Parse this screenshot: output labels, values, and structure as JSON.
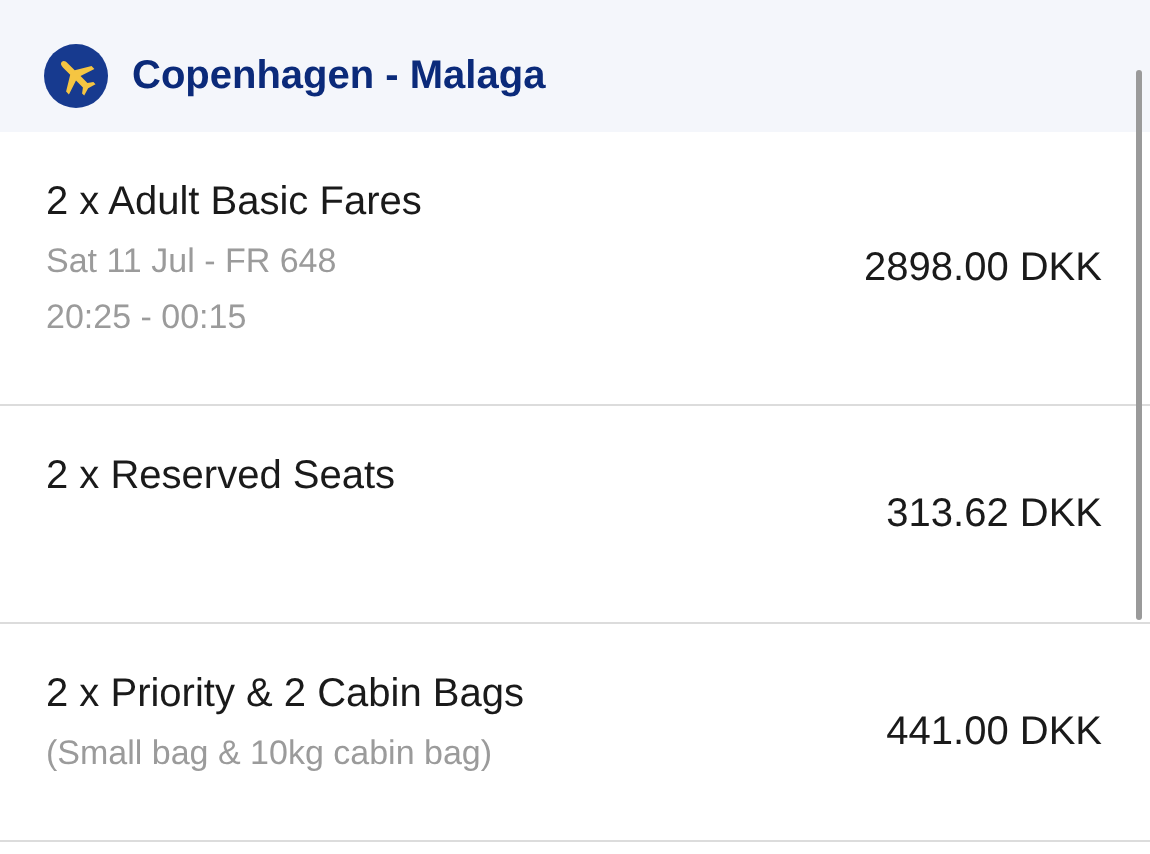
{
  "header": {
    "title": "Copenhagen - Malaga"
  },
  "items": [
    {
      "title": "2 x Adult Basic Fares",
      "details": [
        "Sat 11 Jul - FR 648",
        "20:25 - 00:15"
      ],
      "price": "2898.00 DKK"
    },
    {
      "title": "2 x Reserved Seats",
      "price": "313.62 DKK"
    },
    {
      "title": "2 x Priority & 2 Cabin Bags",
      "details": [
        "(Small bag & 10kg cabin bag)"
      ],
      "price": "441.00 DKK"
    }
  ]
}
